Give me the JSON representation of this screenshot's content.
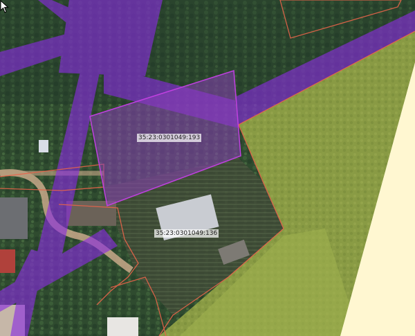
{
  "map": {
    "parcels": [
      {
        "id": "p193",
        "label": "35:23:0301049:193",
        "selected": true
      },
      {
        "id": "p136",
        "label": "35:23:0301049:136",
        "selected": false
      }
    ],
    "colors": {
      "selected_fill": "#8a3fb8",
      "selected_stroke": "#c040e0",
      "zone_overlay": "#8a2be2",
      "parcel_border": "#e8644a",
      "field": "#9aa84a",
      "forest": "#2e4b30",
      "background_cream": "#fff7d1"
    },
    "overlays": [
      "purple-zone-bands"
    ],
    "cursor": "arrow-cursor-icon"
  }
}
